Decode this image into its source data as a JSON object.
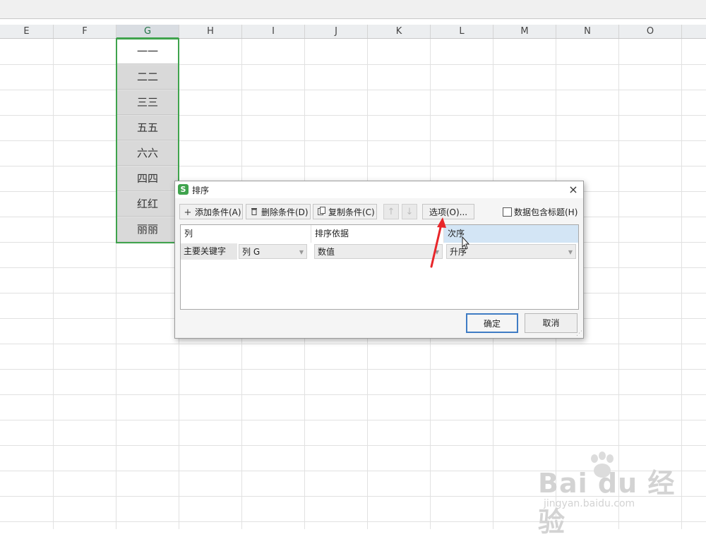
{
  "columns": [
    "E",
    "F",
    "G",
    "H",
    "I",
    "J",
    "K",
    "L",
    "M",
    "N",
    "O"
  ],
  "selected_column": "G",
  "cells_g": [
    "一一",
    "二二",
    "三三",
    "五五",
    "六六",
    "四四",
    "红红",
    "丽丽"
  ],
  "dialog": {
    "icon_letter": "S",
    "title": "排序",
    "close": "×",
    "toolbar": {
      "add": "添加条件(A)",
      "delete": "删除条件(D)",
      "copy": "复制条件(C)",
      "up": "↑",
      "down": "↓",
      "options": "选项(O)...",
      "header_checkbox": "数据包含标题(H)",
      "header_checked": false
    },
    "table_headers": [
      "列",
      "排序依据",
      "次序"
    ],
    "row": {
      "label": "主要关键字",
      "column": "列 G",
      "sort_on": "数值",
      "order": "升序"
    },
    "ok": "确定",
    "cancel": "取消"
  },
  "watermark": {
    "text": "Bai du 经验",
    "url": "jingyan.baidu.com"
  },
  "colors": {
    "selection_green": "#3fa34d",
    "ok_border": "#3f7cc4",
    "annotation_red": "#e8262a",
    "header_highlight": "#d3e5f5"
  },
  "icons": [
    "plus-icon",
    "trash-icon",
    "copy-icon",
    "arrow-up-icon",
    "arrow-down-icon",
    "close-icon",
    "dropdown-arrow-icon",
    "mouse-cursor-icon",
    "red-annotation-arrow"
  ]
}
